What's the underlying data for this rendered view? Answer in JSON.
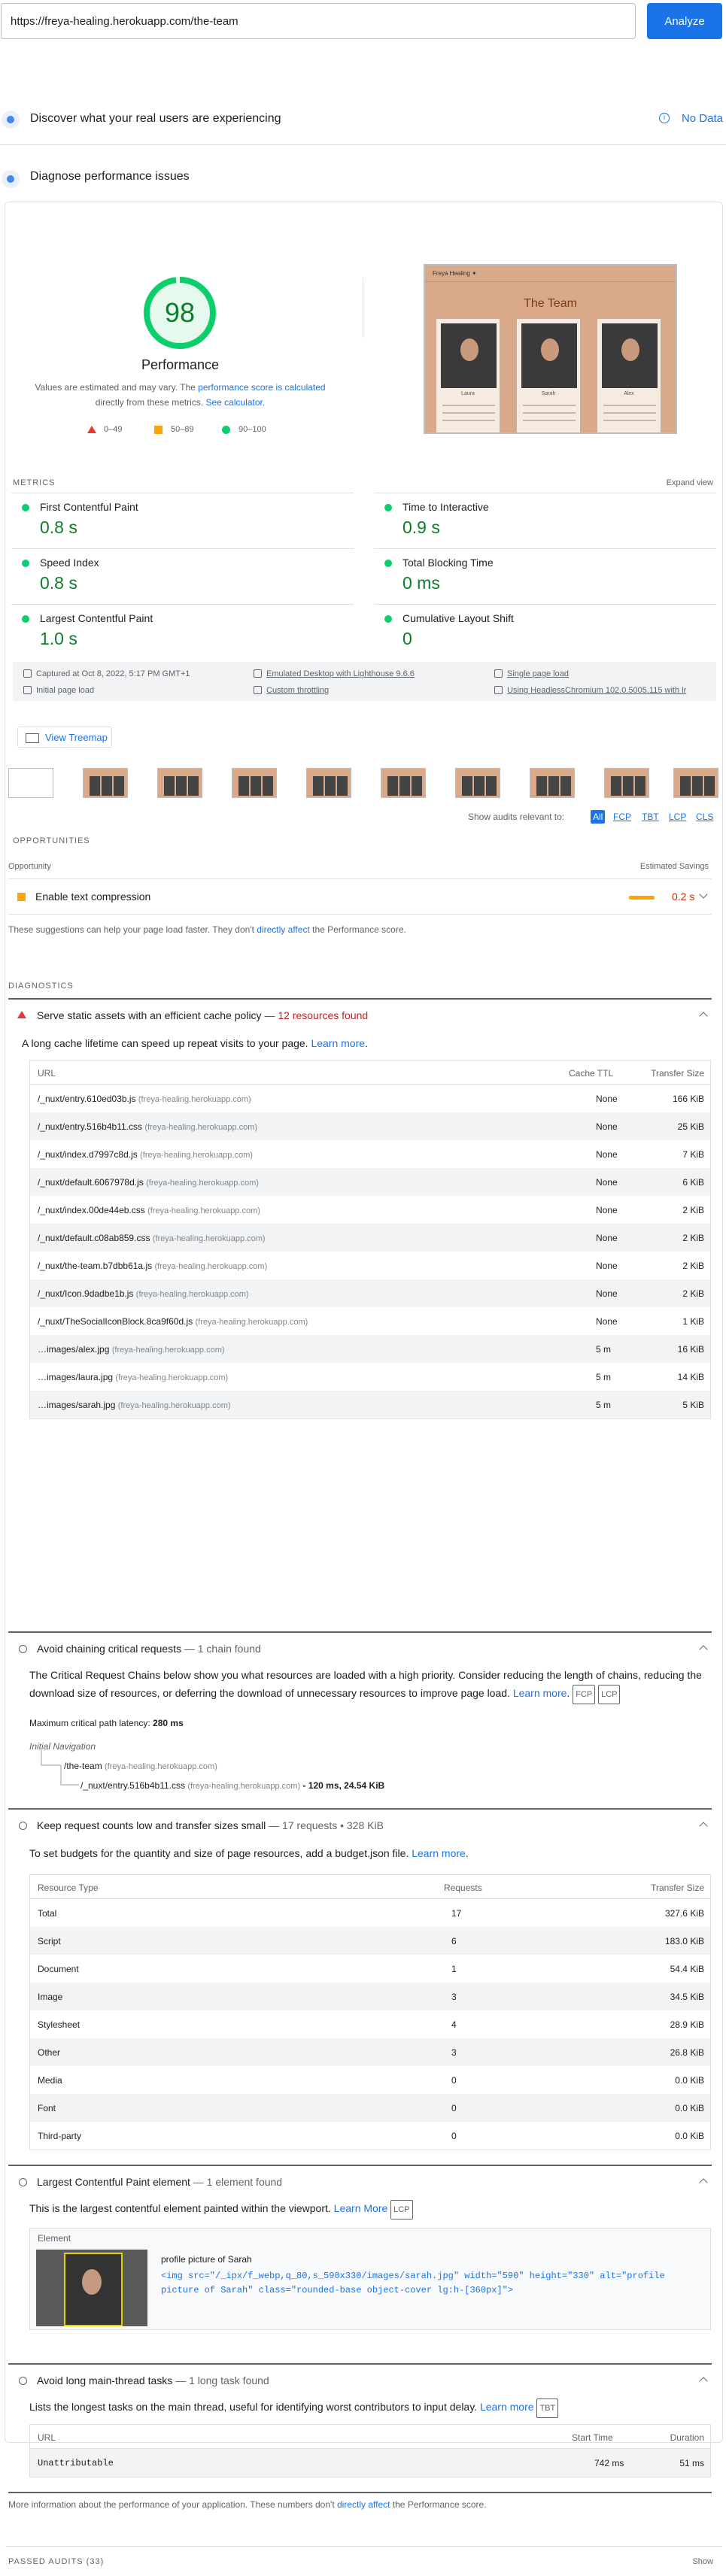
{
  "search": {
    "url": "https://freya-healing.herokuapp.com/the-team",
    "analyze_label": "Analyze"
  },
  "crux": {
    "title": "Discover what your real users are experiencing",
    "no_data": "No Data"
  },
  "diagnose": {
    "title": "Diagnose performance issues"
  },
  "score": {
    "value": "98",
    "label": "Performance",
    "desc_part1": "Values are estimated and may vary. The ",
    "desc_link1": "performance score is calculated",
    "desc_part2": " directly from these metrics. ",
    "desc_link2": "See calculator.",
    "legend": [
      "0–49",
      "50–89",
      "90–100"
    ],
    "color": "#0cce6b"
  },
  "screenshot": {
    "site_name": "Freya Healing ✦",
    "page_title": "The Team",
    "people": [
      "Laura",
      "Sarah",
      "Alex"
    ]
  },
  "metrics": {
    "label": "METRICS",
    "expand": "Expand view",
    "items": [
      {
        "name": "First Contentful Paint",
        "value": "0.8 s"
      },
      {
        "name": "Time to Interactive",
        "value": "0.9 s"
      },
      {
        "name": "Speed Index",
        "value": "0.8 s"
      },
      {
        "name": "Total Blocking Time",
        "value": "0 ms"
      },
      {
        "name": "Largest Contentful Paint",
        "value": "1.0 s"
      },
      {
        "name": "Cumulative Layout Shift",
        "value": "0"
      }
    ]
  },
  "env": {
    "captured": "Captured at Oct 8, 2022, 5:17 PM GMT+1",
    "device": "Emulated Desktop with Lighthouse 9.6.6",
    "session": "Single page load",
    "load": "Initial page load",
    "throttling": "Custom throttling",
    "browser": "Using HeadlessChromium 102.0.5005.115 with lr"
  },
  "treemap_label": "View Treemap",
  "filter": {
    "label": "Show audits relevant to:",
    "chips": [
      "All",
      "FCP",
      "TBT",
      "LCP",
      "CLS"
    ]
  },
  "opportunities": {
    "label": "OPPORTUNITIES",
    "col_left": "Opportunity",
    "col_right": "Estimated Savings",
    "items": [
      {
        "title": "Enable text compression",
        "savings": "0.2 s"
      }
    ],
    "note_part1": "These suggestions can help your page load faster. They don't ",
    "note_link": "directly affect",
    "note_part2": " the Performance score."
  },
  "diagnostics": {
    "label": "DIAGNOSTICS",
    "cache": {
      "title": "Serve static assets with an efficient cache policy",
      "sub": " — 12 resources found",
      "desc": "A long cache lifetime can speed up repeat visits to your page. ",
      "learn": "Learn more",
      "cols": [
        "URL",
        "Cache TTL",
        "Transfer Size"
      ],
      "rows": [
        {
          "url": "/_nuxt/entry.610ed03b.js",
          "host": "(freya-healing.herokuapp.com)",
          "ttl": "None",
          "size": "166 KiB"
        },
        {
          "url": "/_nuxt/entry.516b4b11.css",
          "host": "(freya-healing.herokuapp.com)",
          "ttl": "None",
          "size": "25 KiB"
        },
        {
          "url": "/_nuxt/index.d7997c8d.js",
          "host": "(freya-healing.herokuapp.com)",
          "ttl": "None",
          "size": "7 KiB"
        },
        {
          "url": "/_nuxt/default.6067978d.js",
          "host": "(freya-healing.herokuapp.com)",
          "ttl": "None",
          "size": "6 KiB"
        },
        {
          "url": "/_nuxt/index.00de44eb.css",
          "host": "(freya-healing.herokuapp.com)",
          "ttl": "None",
          "size": "2 KiB"
        },
        {
          "url": "/_nuxt/default.c08ab859.css",
          "host": "(freya-healing.herokuapp.com)",
          "ttl": "None",
          "size": "2 KiB"
        },
        {
          "url": "/_nuxt/the-team.b7dbb61a.js",
          "host": "(freya-healing.herokuapp.com)",
          "ttl": "None",
          "size": "2 KiB"
        },
        {
          "url": "/_nuxt/Icon.9dadbe1b.js",
          "host": "(freya-healing.herokuapp.com)",
          "ttl": "None",
          "size": "2 KiB"
        },
        {
          "url": "/_nuxt/TheSocialIconBlock.8ca9f60d.js",
          "host": "(freya-healing.herokuapp.com)",
          "ttl": "None",
          "size": "1 KiB"
        },
        {
          "url": "…images/alex.jpg",
          "host": "(freya-healing.herokuapp.com)",
          "ttl": "5 m",
          "size": "16 KiB"
        },
        {
          "url": "…images/laura.jpg",
          "host": "(freya-healing.herokuapp.com)",
          "ttl": "5 m",
          "size": "14 KiB"
        },
        {
          "url": "…images/sarah.jpg",
          "host": "(freya-healing.herokuapp.com)",
          "ttl": "5 m",
          "size": "5 KiB"
        }
      ]
    },
    "chains": {
      "title": "Avoid chaining critical requests",
      "sub": " — 1 chain found",
      "desc": "The Critical Request Chains below show you what resources are loaded with a high priority. Consider reducing the length of chains, reducing the download size of resources, or deferring the download of unnecessary resources to improve page load. ",
      "learn": "Learn more",
      "latency_label": "Maximum critical path latency: ",
      "latency": "280 ms",
      "nav": "Initial Navigation",
      "root": "/the-team",
      "root_host": "(freya-healing.herokuapp.com)",
      "child": "/_nuxt/entry.516b4b11.css",
      "child_host": "(freya-healing.herokuapp.com)",
      "child_meta": " - 120 ms, 24.54 KiB"
    },
    "requests": {
      "title": "Keep request counts low and transfer sizes small",
      "sub": " — 17 requests • 328 KiB",
      "desc": "To set budgets for the quantity and size of page resources, add a budget.json file. ",
      "learn": "Learn more",
      "cols": [
        "Resource Type",
        "Requests",
        "Transfer Size"
      ],
      "rows": [
        {
          "type": "Total",
          "req": "17",
          "size": "327.6 KiB"
        },
        {
          "type": "Script",
          "req": "6",
          "size": "183.0 KiB"
        },
        {
          "type": "Document",
          "req": "1",
          "size": "54.4 KiB"
        },
        {
          "type": "Image",
          "req": "3",
          "size": "34.5 KiB"
        },
        {
          "type": "Stylesheet",
          "req": "4",
          "size": "28.9 KiB"
        },
        {
          "type": "Other",
          "req": "3",
          "size": "26.8 KiB"
        },
        {
          "type": "Media",
          "req": "0",
          "size": "0.0 KiB"
        },
        {
          "type": "Font",
          "req": "0",
          "size": "0.0 KiB"
        },
        {
          "type": "Third-party",
          "req": "0",
          "size": "0.0 KiB"
        }
      ]
    },
    "lcp": {
      "title": "Largest Contentful Paint element",
      "sub": " — 1 element found",
      "desc": "This is the largest contentful element painted within the viewport. ",
      "learn": "Learn More",
      "col": "Element",
      "element_label": "profile picture of Sarah",
      "snippet": "<img src=\"/_ipx/f_webp,q_80,s_590x330/images/sarah.jpg\" width=\"590\" height=\"330\" alt=\"profile picture of Sarah\" class=\"rounded-base object-cover lg:h-[360px]\">"
    },
    "longtasks": {
      "title": "Avoid long main-thread tasks",
      "sub": " — 1 long task found",
      "desc": "Lists the longest tasks on the main thread, useful for identifying worst contributors to input delay. ",
      "learn": "Learn more",
      "cols": [
        "URL",
        "Start Time",
        "Duration"
      ],
      "rows": [
        {
          "url": "Unattributable",
          "start": "742 ms",
          "duration": "51 ms"
        }
      ]
    },
    "note_part1": "More information about the performance of your application. These numbers don't ",
    "note_link": "directly affect",
    "note_part2": " the Performance score."
  },
  "passed": {
    "label": "PASSED AUDITS",
    "count": "(33)",
    "show": "Show"
  },
  "badges": {
    "fcp": "FCP",
    "lcp": "LCP",
    "tbt": "TBT"
  }
}
